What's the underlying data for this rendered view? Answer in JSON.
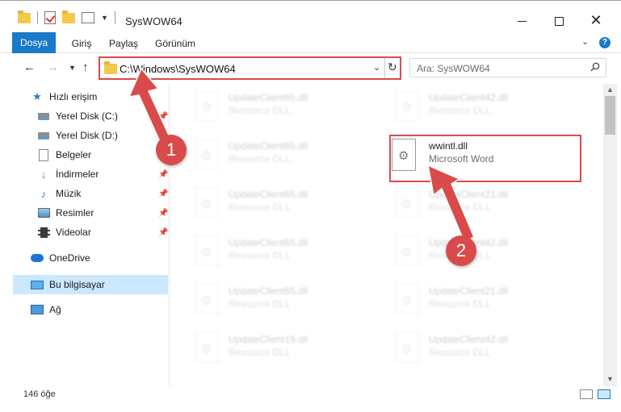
{
  "window": {
    "title": "SysWOW64",
    "minimize_icon": "minimize-icon",
    "maximize_icon": "maximize-icon",
    "close_icon": "close-icon"
  },
  "ribbon": {
    "tabs": [
      "Dosya",
      "Giriş",
      "Paylaş",
      "Görünüm"
    ]
  },
  "addressbar": {
    "path": "C:\\Windows\\SysWOW64",
    "search_placeholder": "Ara: SysWOW64"
  },
  "nav": {
    "items": [
      {
        "label": "Hızlı erişim",
        "icon": "quick-access-star-icon"
      },
      {
        "label": "Yerel Disk (C:)",
        "icon": "drive-icon"
      },
      {
        "label": "Yerel Disk (D:)",
        "icon": "drive-icon"
      },
      {
        "label": "Belgeler",
        "icon": "documents-icon"
      },
      {
        "label": "İndirmeler",
        "icon": "downloads-icon"
      },
      {
        "label": "Müzik",
        "icon": "music-icon"
      },
      {
        "label": "Resimler",
        "icon": "pictures-icon"
      },
      {
        "label": "Videolar",
        "icon": "videos-icon"
      },
      {
        "label": "OneDrive",
        "icon": "onedrive-icon"
      },
      {
        "label": "Bu bilgisayar",
        "icon": "this-pc-icon"
      },
      {
        "label": "Ağ",
        "icon": "network-icon"
      }
    ]
  },
  "files": {
    "left": [
      {
        "name": "UpdateClient65.dll",
        "desc": "Resource DLL"
      },
      {
        "name": "UpdateClient65.dll",
        "desc": "Resource DLL"
      },
      {
        "name": "UpdateClient65.dll",
        "desc": "Resource DLL"
      },
      {
        "name": "UpdateClient65.dll",
        "desc": "Resource DLL"
      },
      {
        "name": "UpdateClient65.dll",
        "desc": "Resource DLL"
      },
      {
        "name": "UpdateClient19.dll",
        "desc": "Resource DLL"
      }
    ],
    "right": [
      {
        "name": "UpdateClient42.dll",
        "desc": "Resource DLL"
      },
      {
        "name": "wwintl.dll",
        "desc": "Microsoft Word"
      },
      {
        "name": "UpdateClient21.dll",
        "desc": "Resource DLL"
      },
      {
        "name": "UpdateClient42.dll",
        "desc": "Resource DLL"
      },
      {
        "name": "UpdateClient21.dll",
        "desc": "Resource DLL"
      },
      {
        "name": "UpdateClient42.dll",
        "desc": "Resource DLL"
      }
    ]
  },
  "status": {
    "count": "146 öğe"
  },
  "annotations": {
    "badge1": "1",
    "badge2": "2",
    "color": "#d94b4b"
  }
}
